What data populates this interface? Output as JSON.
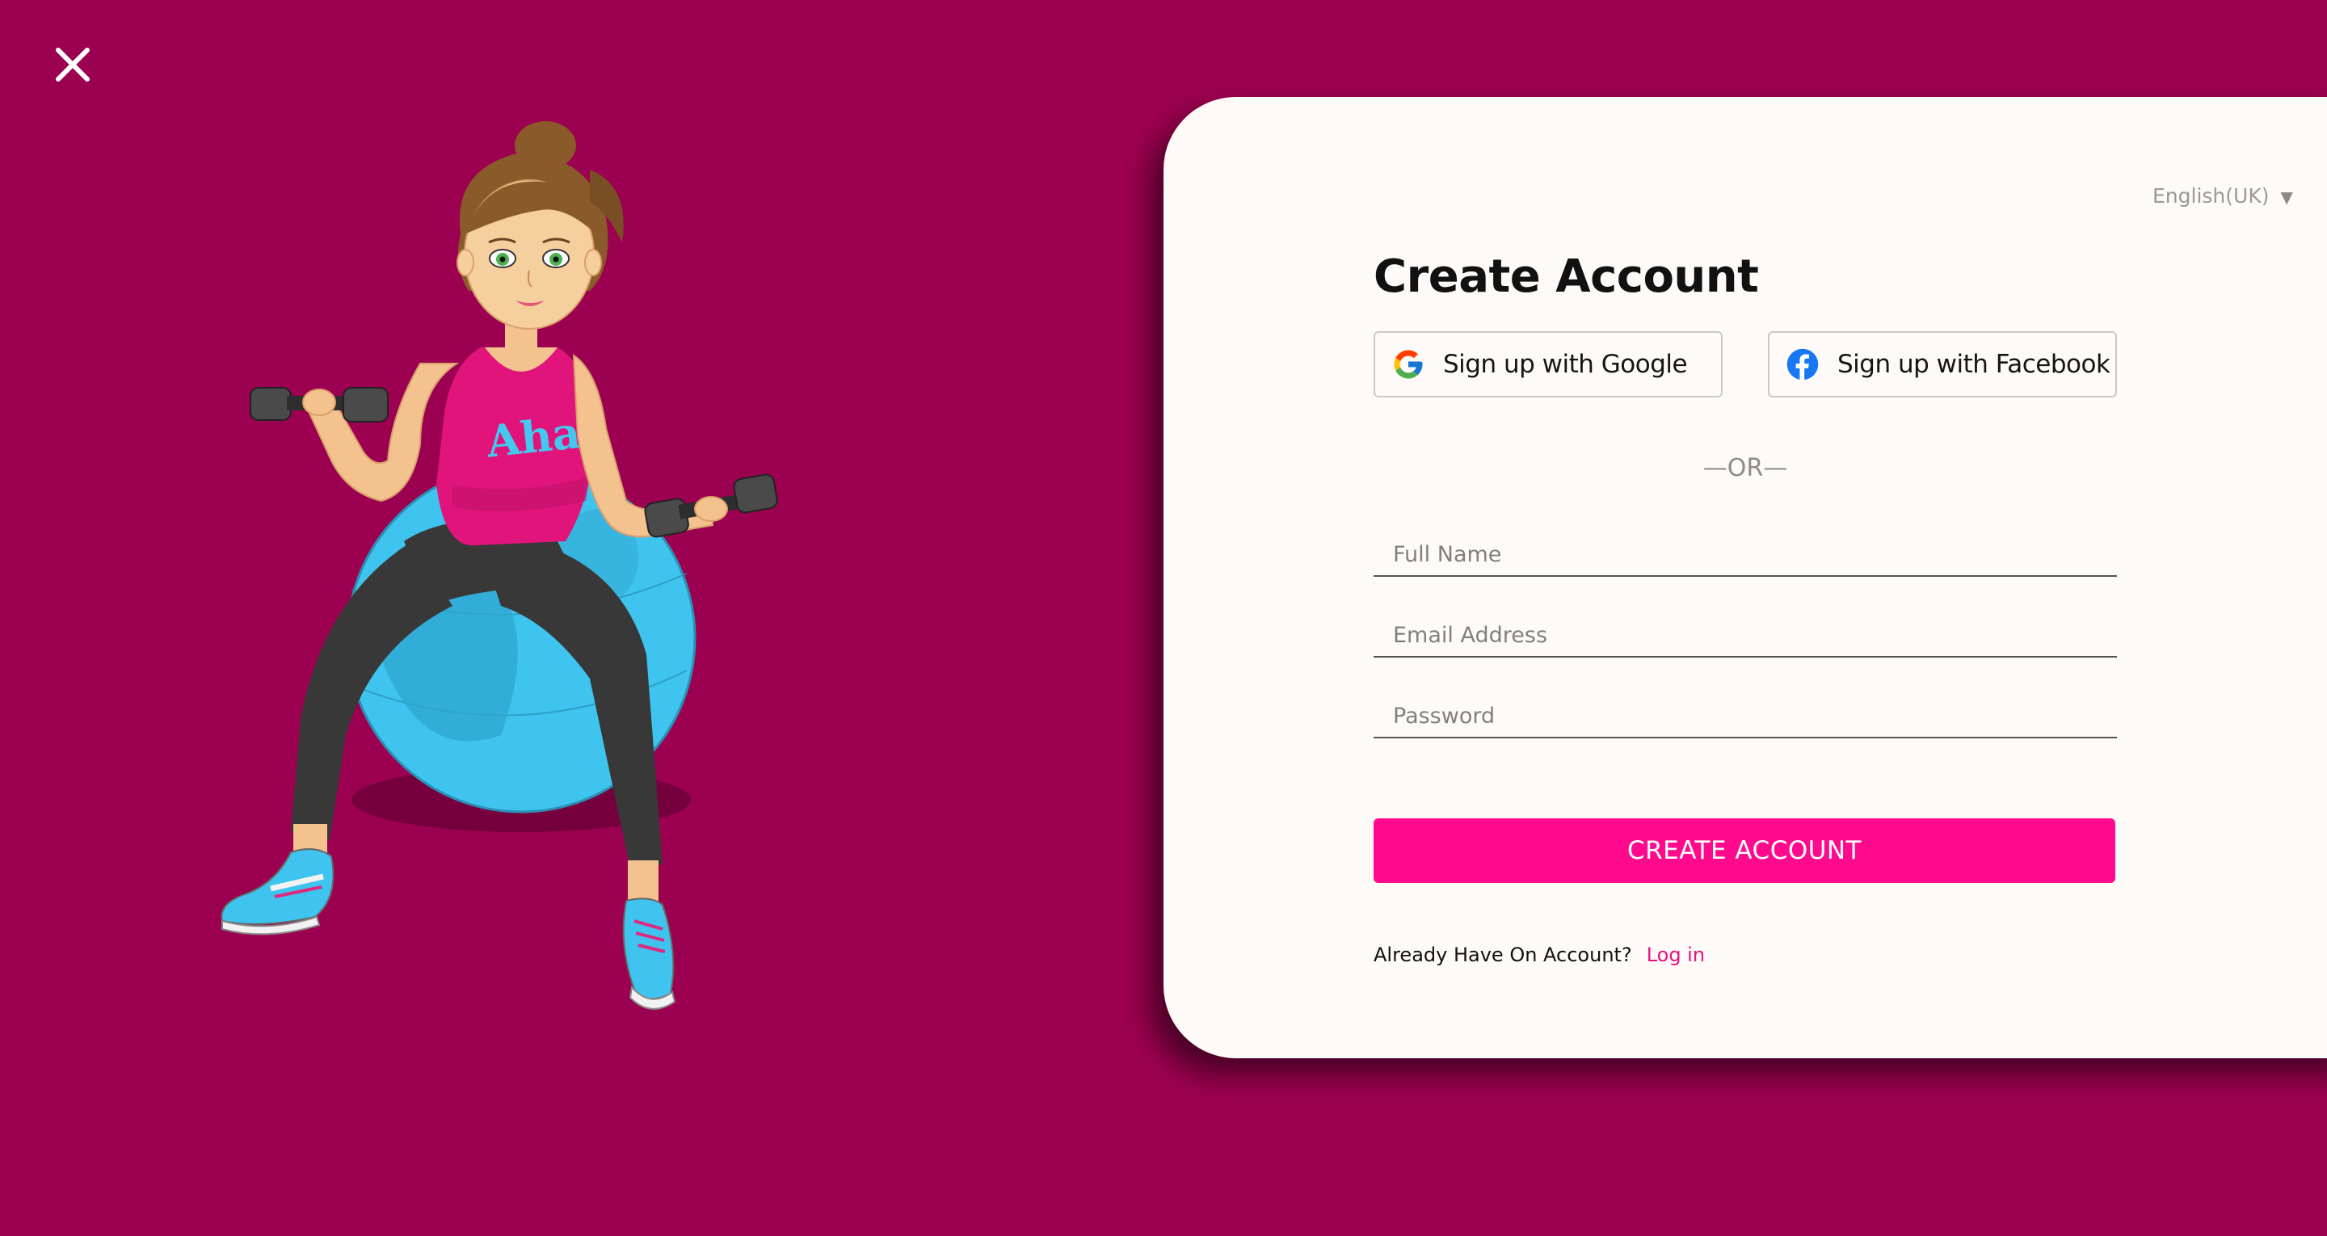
{
  "close": {
    "icon": "close-icon"
  },
  "language": {
    "selected": "English(UK)",
    "caret": "▼"
  },
  "form": {
    "title": "Create Account",
    "google_label": "Sign up with Google",
    "facebook_label": "Sign up with Facebook",
    "or_text": "—OR—",
    "full_name": {
      "placeholder": "Full Name",
      "value": ""
    },
    "email": {
      "placeholder": "Email Address",
      "value": ""
    },
    "password": {
      "placeholder": "Password",
      "value": ""
    },
    "submit_label": "CREATE ACCOUNT",
    "login_prompt": "Already Have On Account?",
    "login_link": "Log in"
  },
  "illustration": {
    "shirt_text": "Aha!"
  },
  "colors": {
    "background": "#9c0050",
    "card": "#fefaf8",
    "accent": "#ff0a8d",
    "link": "#e6127f",
    "ball": "#3ec4ee"
  }
}
